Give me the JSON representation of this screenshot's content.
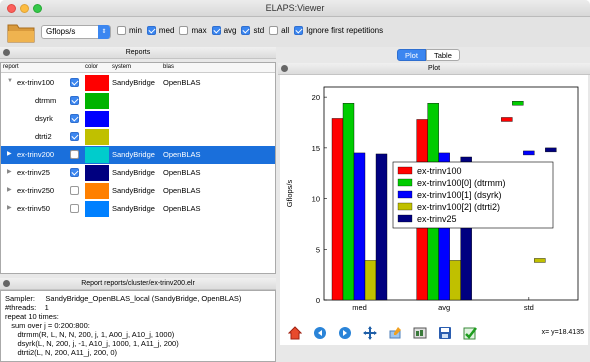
{
  "window": {
    "title": "ELAPS:Viewer"
  },
  "toolbar": {
    "metric": "Gflops/s",
    "options": [
      {
        "label": "min",
        "checked": false
      },
      {
        "label": "med",
        "checked": true
      },
      {
        "label": "max",
        "checked": false
      },
      {
        "label": "avg",
        "checked": true
      },
      {
        "label": "std",
        "checked": true
      },
      {
        "label": "all",
        "checked": false
      },
      {
        "label": "Ignore first repetitions",
        "checked": true
      }
    ]
  },
  "reports_panel": {
    "title": "Reports",
    "columns": [
      "report",
      "color",
      "system",
      "blas"
    ],
    "rows": [
      {
        "name": "ex-trinv100",
        "color": "#ff0000",
        "system": "SandyBridge",
        "blas": "OpenBLAS",
        "checked": true,
        "expanded": true,
        "selected": false
      },
      {
        "name": "dtrmm",
        "color": "#00b300",
        "system": "",
        "blas": "",
        "checked": true,
        "child": true,
        "selected": false
      },
      {
        "name": "dsyrk",
        "color": "#0000ff",
        "system": "",
        "blas": "",
        "checked": true,
        "child": true,
        "selected": false
      },
      {
        "name": "dtrti2",
        "color": "#c0c000",
        "system": "",
        "blas": "",
        "checked": true,
        "child": true,
        "selected": false
      },
      {
        "name": "ex-trinv200",
        "color": "#00cccc",
        "system": "SandyBridge",
        "blas": "OpenBLAS",
        "checked": false,
        "selected": true
      },
      {
        "name": "ex-trinv25",
        "color": "#000080",
        "system": "SandyBridge",
        "blas": "OpenBLAS",
        "checked": true,
        "selected": false
      },
      {
        "name": "ex-trinv250",
        "color": "#ff8000",
        "system": "SandyBridge",
        "blas": "OpenBLAS",
        "checked": false,
        "selected": false
      },
      {
        "name": "ex-trinv50",
        "color": "#0080ff",
        "system": "SandyBridge",
        "blas": "OpenBLAS",
        "checked": false,
        "selected": false
      }
    ]
  },
  "report_panel": {
    "title": "Report reports/cluster/ex-trinv200.elr",
    "lines": [
      "Sampler:     SandyBridge_OpenBLAS_local (SandyBridge, OpenBLAS)",
      "#threads:    1",
      "repeat 10 times:",
      "   sum over j = 0:200:800:",
      "      dtrmm(R, L, N, N, 200, j, 1, A00_j, A10_j, 1000)",
      "      dsyrk(L, N, 200, j, -1, A10_j, 1000, 1, A11_j, 200)",
      "      dtrti2(L, N, 200, A11_j, 200, 0)"
    ]
  },
  "plot_panel": {
    "tabs": [
      "Plot",
      "Table"
    ],
    "active_tab": "Plot",
    "title": "Plot",
    "coord_readout": "x= y=18.4135",
    "toolbar_icons": [
      "home-icon",
      "back-icon",
      "forward-icon",
      "pan-icon",
      "configure-icon",
      "subplots-icon",
      "save-icon",
      "check-icon"
    ]
  },
  "chart_data": {
    "type": "bar",
    "ylabel": "Gflops/s",
    "xlabel": "",
    "ylim": [
      0,
      21
    ],
    "yticks": [
      0,
      5,
      10,
      15,
      20
    ],
    "categories": [
      "med",
      "avg",
      "std"
    ],
    "series": [
      {
        "name": "ex-trinv100",
        "color": "#ff0000",
        "values": [
          17.9,
          17.8,
          17.8
        ]
      },
      {
        "name": "ex-trinv100[0] (dtrmm)",
        "color": "#00cc00",
        "values": [
          19.4,
          19.4,
          19.4
        ]
      },
      {
        "name": "ex-trinv100[1] (dsyrk)",
        "color": "#0000ff",
        "values": [
          14.5,
          14.5,
          14.5
        ]
      },
      {
        "name": "ex-trinv100[2] (dtrti2)",
        "color": "#c0c000",
        "values": [
          3.9,
          3.9,
          3.9
        ]
      },
      {
        "name": "ex-trinv25",
        "color": "#000080",
        "values": [
          14.4,
          14.1,
          14.8
        ]
      }
    ],
    "legend": "center-right"
  }
}
